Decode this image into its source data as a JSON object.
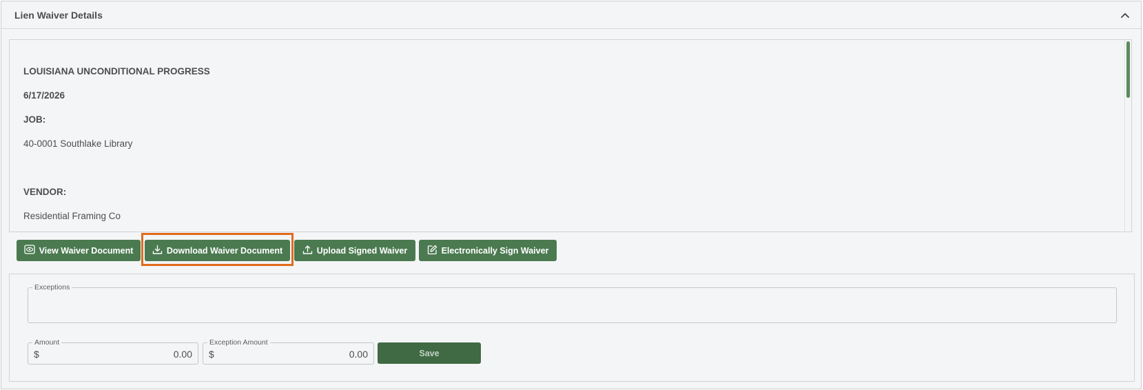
{
  "panel": {
    "title": "Lien Waiver Details"
  },
  "document": {
    "heading": "LOUISIANA UNCONDITIONAL PROGRESS",
    "date": "6/17/2026",
    "job_label": "JOB:",
    "job_value": "40-0001 Southlake Library",
    "vendor_label": "VENDOR:",
    "vendor_value": "Residential Framing Co"
  },
  "actions": {
    "view_label": "View Waiver Document",
    "download_label": "Download Waiver Document",
    "upload_label": "Upload Signed Waiver",
    "sign_label": "Electronically Sign Waiver"
  },
  "form": {
    "exceptions_label": "Exceptions",
    "exceptions_value": "",
    "amount_label": "Amount",
    "amount_currency": "$",
    "amount_value": "0.00",
    "exception_amount_label": "Exception Amount",
    "exception_amount_currency": "$",
    "exception_amount_value": "0.00",
    "save_label": "Save"
  },
  "colors": {
    "accent": "#4b7a50",
    "highlight": "#e06b1d"
  }
}
